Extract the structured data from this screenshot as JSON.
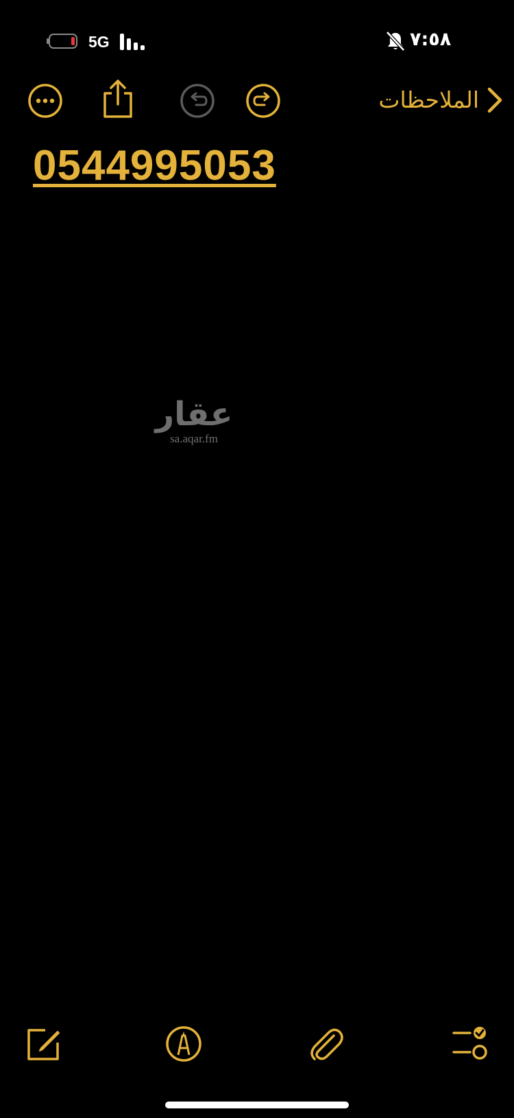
{
  "status_bar": {
    "network": "5G",
    "time": "٧:٥٨",
    "battery_low_color": "#E53935"
  },
  "nav": {
    "back_label": "الملاحظات",
    "accent_color": "#E4B23A",
    "icons": [
      "ellipsis-circle-icon",
      "share-icon",
      "undo-icon",
      "redo-icon",
      "chevron-right-icon"
    ]
  },
  "note": {
    "text": "0544995053"
  },
  "watermark": {
    "logo": "عقار",
    "url": "sa.aqar.fm"
  },
  "toolbar": {
    "icons": [
      "compose-icon",
      "markup-icon",
      "paperclip-icon",
      "checklist-icon"
    ]
  }
}
